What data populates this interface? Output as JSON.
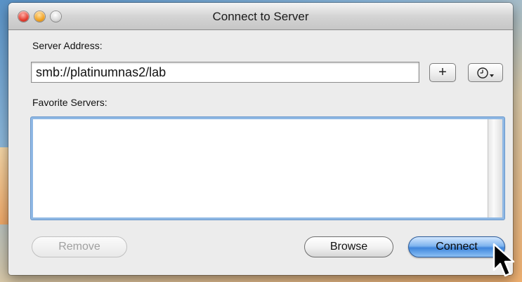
{
  "window": {
    "title": "Connect to Server"
  },
  "server_address": {
    "label": "Server Address:",
    "value": "smb://platinumnas2/lab",
    "add_button": "+"
  },
  "favorites": {
    "label": "Favorite Servers:",
    "items": []
  },
  "buttons": {
    "remove": "Remove",
    "browse": "Browse",
    "connect": "Connect"
  },
  "colors": {
    "default_button": "#3f86dc",
    "list_focus_ring": "#8fb8e4",
    "close_light": "#e23a2c",
    "minimize_light": "#f0a020"
  }
}
